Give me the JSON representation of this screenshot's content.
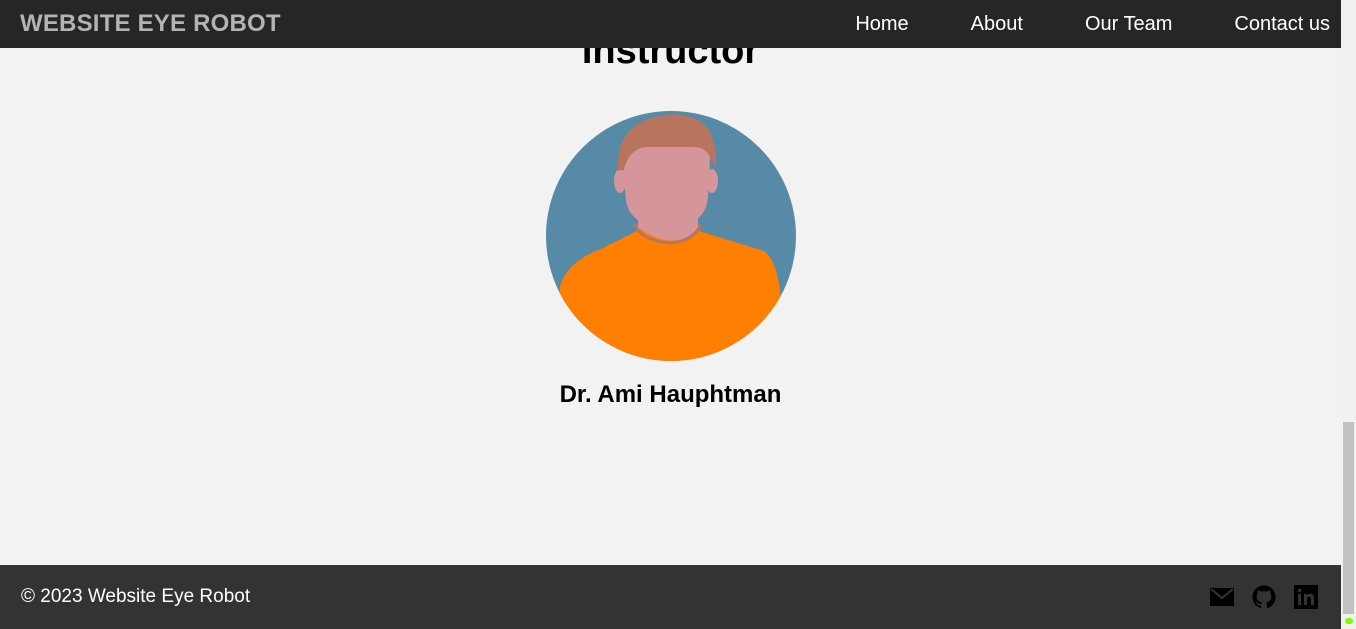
{
  "navbar": {
    "brand": "WEBSITE EYE ROBOT",
    "links": [
      "Home",
      "About",
      "Our Team",
      "Contact us"
    ]
  },
  "section": {
    "title": "Instructor"
  },
  "instructor": {
    "name": "Dr. Ami Hauphtman",
    "avatar_colors": {
      "background": "#568aa6",
      "shirt": "#ff7f02",
      "skin": "#d4959b",
      "hair": "#b9745e"
    }
  },
  "footer": {
    "copyright": "© 2023 Website Eye Robot",
    "social_icons": [
      "email-icon",
      "github-icon",
      "linkedin-icon"
    ]
  },
  "colors": {
    "navbar_bg": "#262626",
    "footer_bg": "#333333",
    "page_bg": "#f2f2f2",
    "brand_text": "#b3b3b3"
  }
}
